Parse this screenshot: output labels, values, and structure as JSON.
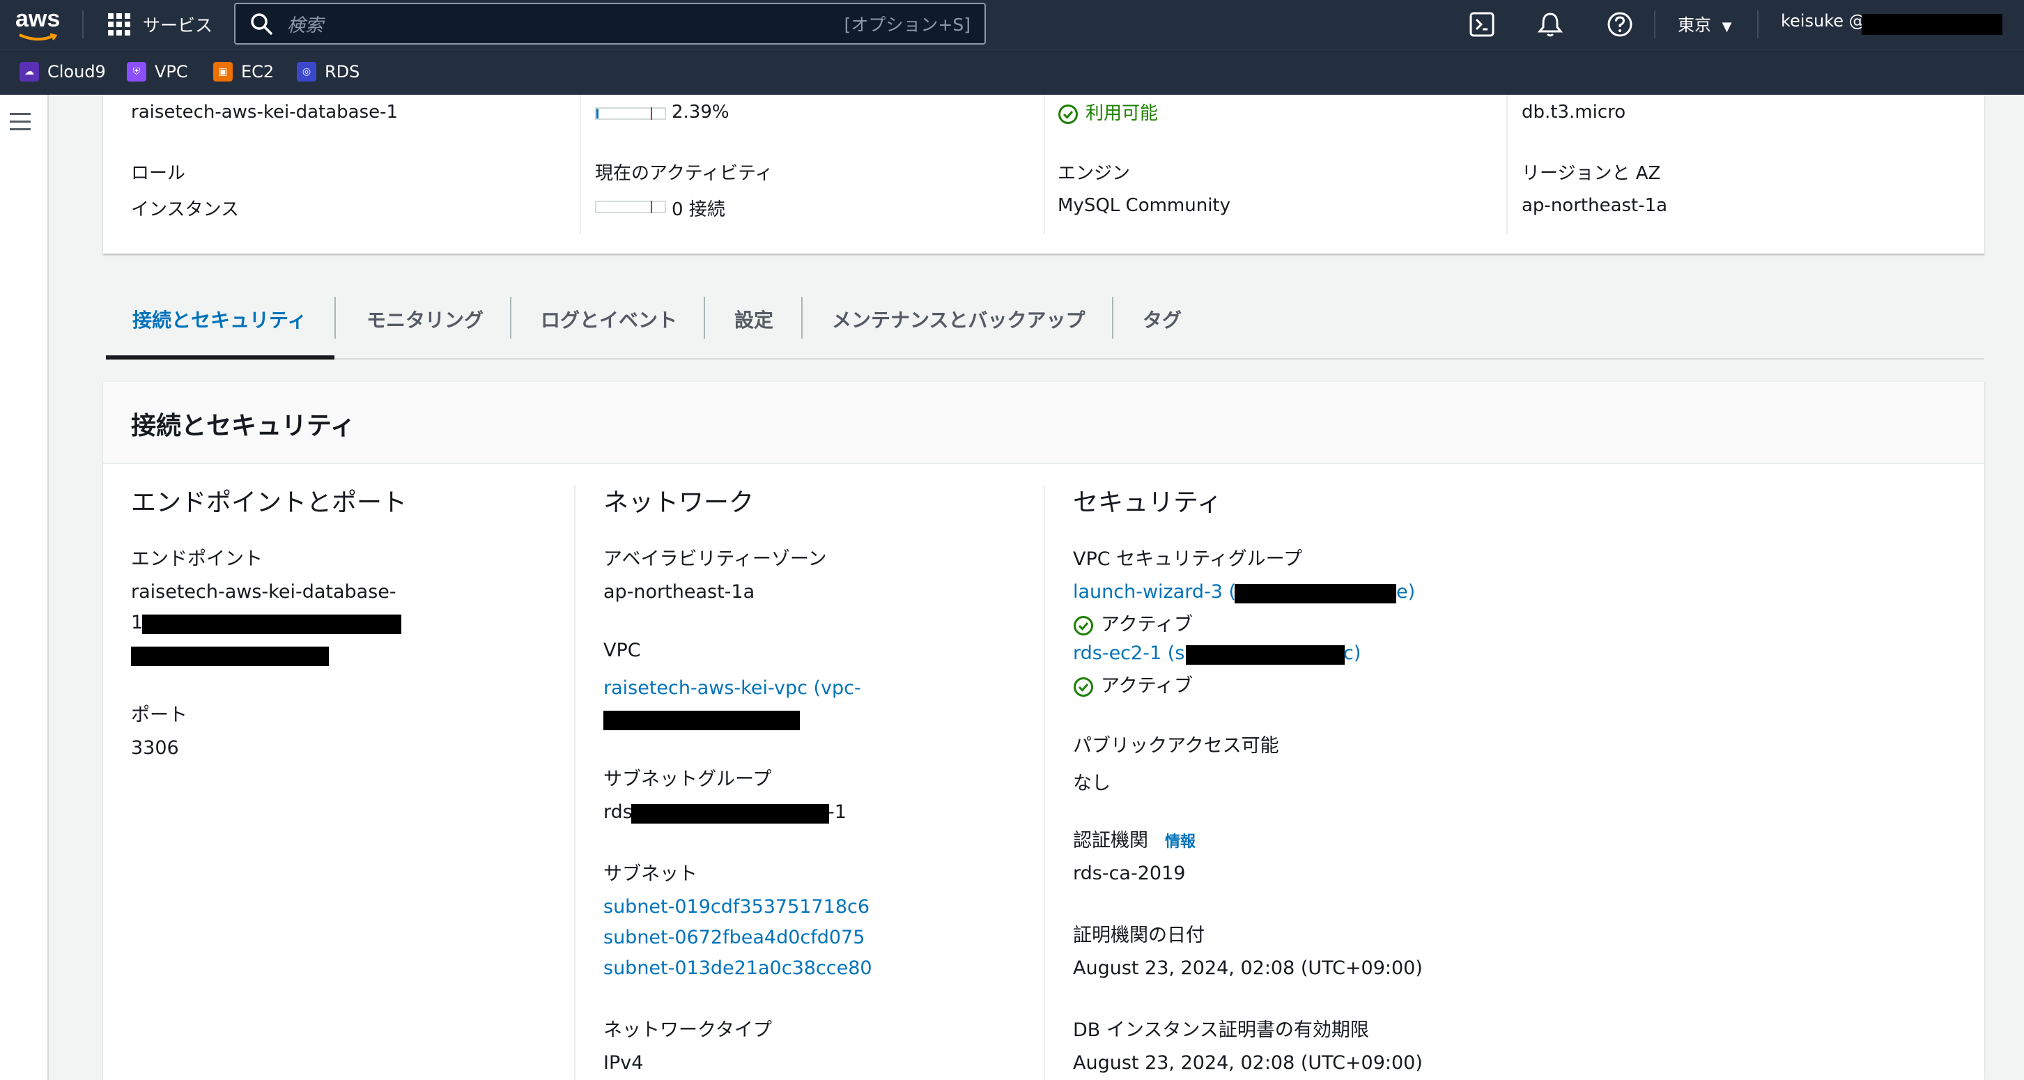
{
  "topnav": {
    "logo": "aws",
    "services_label": "サービス",
    "search_placeholder": "検索",
    "search_shortcut": "[オプション+S]",
    "region": "東京",
    "user": "keisuke @"
  },
  "favorites": [
    {
      "label": "Cloud9",
      "icon": "cloud9-icon",
      "color": "#5a30b5"
    },
    {
      "label": "VPC",
      "icon": "vpc-icon",
      "color": "#8c4fff"
    },
    {
      "label": "EC2",
      "icon": "ec2-icon",
      "color": "#ed7100"
    },
    {
      "label": "RDS",
      "icon": "rds-icon",
      "color": "#3b48cc"
    }
  ],
  "summary": {
    "db_identifier": "raisetech-aws-kei-database-1",
    "cpu_value": "2.39%",
    "cpu_fill_fraction": 0.03,
    "status": "利用可能",
    "class": "db.t3.micro",
    "role_label": "ロール",
    "role_value": "インスタンス",
    "activity_label": "現在のアクティビティ",
    "activity_value": "0 接続",
    "activity_fill_fraction": 0.0,
    "engine_label": "エンジン",
    "engine_value": "MySQL Community",
    "region_az_label": "リージョンと AZ",
    "region_az_value": "ap-northeast-1a"
  },
  "tabs": [
    {
      "label": "接続とセキュリティ",
      "active": true
    },
    {
      "label": "モニタリング",
      "active": false
    },
    {
      "label": "ログとイベント",
      "active": false
    },
    {
      "label": "設定",
      "active": false
    },
    {
      "label": "メンテナンスとバックアップ",
      "active": false
    },
    {
      "label": "タグ",
      "active": false
    }
  ],
  "panel": {
    "title": "接続とセキュリティ",
    "endpoint_section": {
      "title": "エンドポイントとポート",
      "endpoint_label": "エンドポイント",
      "endpoint_value_line1": "raisetech-aws-kei-database-",
      "endpoint_value_line2": "1",
      "port_label": "ポート",
      "port_value": "3306"
    },
    "network_section": {
      "title": "ネットワーク",
      "az_label": "アベイラビリティーゾーン",
      "az_value": "ap-northeast-1a",
      "vpc_label": "VPC",
      "vpc_value": "raisetech-aws-kei-vpc (vpc-",
      "subnet_group_label": "サブネットグループ",
      "subnet_group_prefix": "rds",
      "subnet_group_suffix": "-1",
      "subnets_label": "サブネット",
      "subnets": [
        "subnet-019cdf353751718c6",
        "subnet-0672fbea4d0cfd075",
        "subnet-013de21a0c38cce80"
      ],
      "network_type_label": "ネットワークタイプ",
      "network_type_value": "IPv4"
    },
    "security_section": {
      "title": "セキュリティ",
      "sg_label": "VPC セキュリティグループ",
      "sg1_prefix": "launch-wizard-3 (s",
      "sg1_suffix": "e)",
      "sg1_status": "アクティブ",
      "sg2_prefix": "rds-ec2-1 (s",
      "sg2_suffix": "c)",
      "sg2_status": "アクティブ",
      "public_label": "パブリックアクセス可能",
      "public_value": "なし",
      "ca_label": "認証機関",
      "ca_info": "情報",
      "ca_value": "rds-ca-2019",
      "ca_date_label": "証明機関の日付",
      "ca_date_value": "August 23, 2024, 02:08 (UTC+09:00)",
      "cert_expiry_label": "DB インスタンス証明書の有効期限",
      "cert_expiry_value": "August 23, 2024, 02:08 (UTC+09:00)"
    }
  }
}
